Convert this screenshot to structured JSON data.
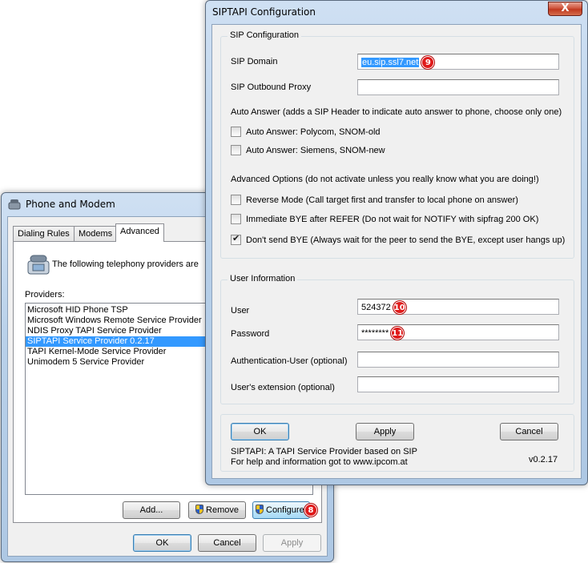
{
  "phone_modem": {
    "title": "Phone and Modem",
    "tabs": [
      "Dialing Rules",
      "Modems",
      "Advanced"
    ],
    "description": "The following telephony providers are",
    "providers_label": "Providers:",
    "providers": [
      "Microsoft HID Phone TSP",
      "Microsoft Windows Remote Service Provider",
      "NDIS Proxy TAPI Service Provider",
      "SIPTAPI Service Provider 0.2.17",
      "TAPI Kernel-Mode Service Provider",
      "Unimodem 5 Service Provider"
    ],
    "selected_index": 3,
    "add_label": "Add...",
    "remove_label": "Remove",
    "configure_label": "Configure",
    "configure_badge": "8",
    "ok_label": "OK",
    "cancel_label": "Cancel",
    "apply_label": "Apply"
  },
  "siptapi": {
    "title": "SIPTAPI Configuration",
    "close_glyph": "X",
    "sip_group": {
      "title": "SIP Configuration",
      "domain_label": "SIP Domain",
      "domain_value": "eu.sip.ssl7.net",
      "domain_badge": "9",
      "proxy_label": "SIP Outbound Proxy",
      "proxy_value": "",
      "auto_answer_header": "Auto Answer (adds a SIP Header to indicate auto answer to phone, choose only one)",
      "aa_polycom": "Auto Answer: Polycom, SNOM-old",
      "aa_siemens": "Auto Answer: Siemens, SNOM-new",
      "advanced_header": "Advanced Options (do not activate unless you really know what you are doing!)",
      "reverse_mode": "Reverse Mode (Call target first and transfer to local phone on answer)",
      "immediate_bye": "Immediate BYE after REFER (Do not wait for NOTIFY with sipfrag 200 OK)",
      "dont_send_bye": "Don't send BYE (Always wait for the peer to send the BYE, except user hangs up)"
    },
    "user_group": {
      "title": "User Information",
      "user_label": "User",
      "user_value": "524372",
      "user_badge": "10",
      "password_label": "Password",
      "password_value": "********",
      "password_badge": "11",
      "auth_user_label": "Authentication-User (optional)",
      "auth_user_value": "",
      "extension_label": "User's extension (optional)",
      "extension_value": ""
    },
    "ok_label": "OK",
    "apply_label": "Apply",
    "cancel_label": "Cancel",
    "footer_line1": "SIPTAPI: A TAPI Service Provider based on SIP",
    "footer_line2": "For help and information got to www.ipcom.at",
    "version": "v0.2.17"
  }
}
